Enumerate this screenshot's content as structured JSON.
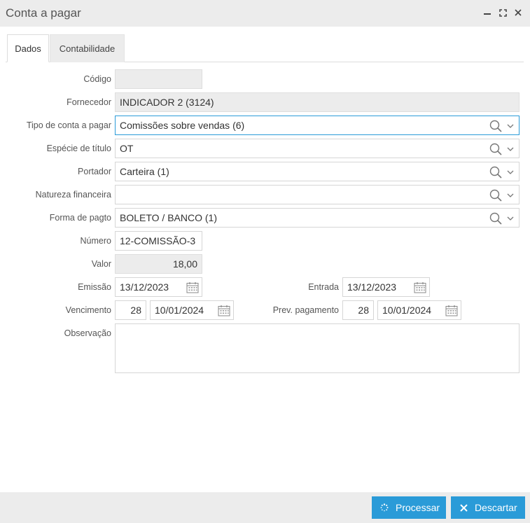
{
  "window": {
    "title": "Conta a pagar",
    "controls": [
      "minimize-icon",
      "maximize-icon",
      "close-icon"
    ]
  },
  "tabs": [
    {
      "label": "Dados",
      "active": true
    },
    {
      "label": "Contabilidade",
      "active": false
    }
  ],
  "form": {
    "codigo": {
      "label": "Código",
      "value": ""
    },
    "fornecedor": {
      "label": "Fornecedor",
      "value": "INDICADOR 2 (3124)"
    },
    "tipo_conta": {
      "label": "Tipo de conta a pagar",
      "value": "Comissões sobre vendas (6)"
    },
    "especie": {
      "label": "Espécie de título",
      "value": "OT"
    },
    "portador": {
      "label": "Portador",
      "value": "Carteira (1)"
    },
    "natureza": {
      "label": "Natureza financeira",
      "value": ""
    },
    "forma_pagto": {
      "label": "Forma de pagto",
      "value": "BOLETO / BANCO (1)"
    },
    "numero": {
      "label": "Número",
      "value": "12-COMISSÃO-3"
    },
    "valor": {
      "label": "Valor",
      "value": "18,00"
    },
    "emissao": {
      "label": "Emissão",
      "value": "13/12/2023"
    },
    "entrada": {
      "label": "Entrada",
      "value": "13/12/2023"
    },
    "vencimento": {
      "label": "Vencimento",
      "days": "28",
      "value": "10/01/2024"
    },
    "prev_pagamento": {
      "label": "Prev. pagamento",
      "days": "28",
      "value": "10/01/2024"
    },
    "observacao": {
      "label": "Observação",
      "value": ""
    }
  },
  "buttons": {
    "processar": "Processar",
    "descartar": "Descartar"
  },
  "colors": {
    "accent": "#2a9bd8",
    "titlebar": "#ececec"
  }
}
